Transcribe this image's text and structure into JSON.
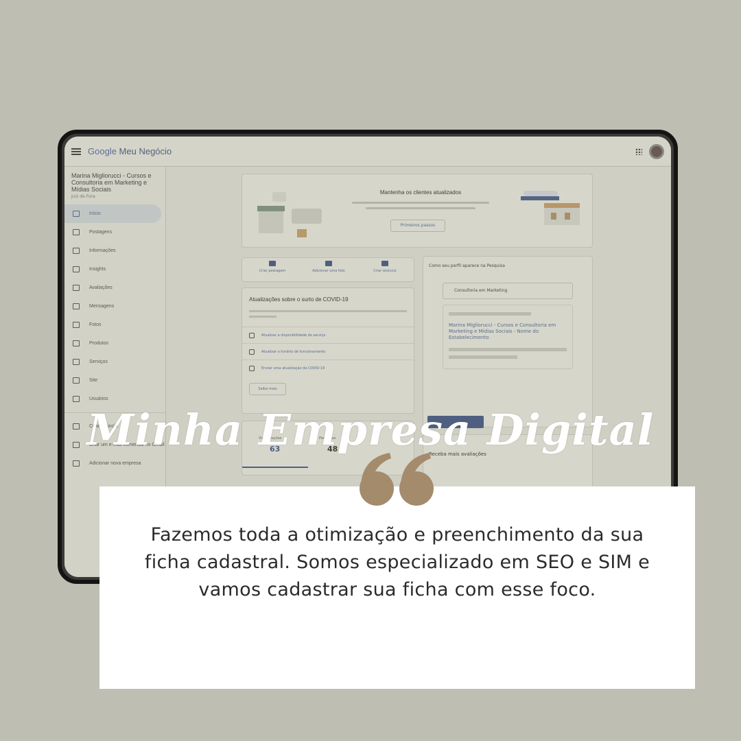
{
  "app": {
    "brand_google": "Google",
    "brand_rest": "Meu Negócio"
  },
  "sidebar": {
    "business_name": "Marina Migliorucci - Cursos e Consultoria em Marketing e Mídias Sociais",
    "location": "Juiz de Fora",
    "items": [
      {
        "label": "Início",
        "icon": "home-icon"
      },
      {
        "label": "Postagens",
        "icon": "posts-icon"
      },
      {
        "label": "Informações",
        "icon": "store-icon"
      },
      {
        "label": "Insights",
        "icon": "insights-icon"
      },
      {
        "label": "Avaliações",
        "icon": "reviews-icon"
      },
      {
        "label": "Mensagens",
        "icon": "messages-icon"
      },
      {
        "label": "Fotos",
        "icon": "photos-icon"
      },
      {
        "label": "Produtos",
        "icon": "products-icon"
      },
      {
        "label": "Serviços",
        "icon": "services-icon"
      },
      {
        "label": "Site",
        "icon": "website-icon"
      },
      {
        "label": "Usuários",
        "icon": "users-icon"
      },
      {
        "label": "Criar anúncio",
        "icon": "ads-icon"
      },
      {
        "label": "Criar um e-mail comercial no Gmail",
        "icon": "gmail-icon"
      },
      {
        "label": "Adicionar nova empresa",
        "icon": "location-icon"
      }
    ]
  },
  "banner": {
    "title": "Mantenha os clientes atualizados",
    "button": "Primeiros passos"
  },
  "actions": [
    "Criar postagem",
    "Adicionar uma foto",
    "Criar anúncio"
  ],
  "covid": {
    "title": "Atualizações sobre o surto de COVID-19",
    "rows": [
      "Atualizar a disponibilidade do serviço",
      "Atualizar o horário de funcionamento",
      "Enviar uma atualização da COVID-19"
    ],
    "more": "Saiba mais"
  },
  "stats": {
    "items": [
      {
        "label": "Visualizações",
        "value": "63"
      },
      {
        "label": "Pesquisas",
        "value": "48"
      }
    ]
  },
  "search_card": {
    "header": "Como seu perfil aparece na Pesquisa",
    "query": "Consultoria em Marketing",
    "result_title": "Marina Migliorucci - Cursos e Consultoria em Marketing e Mídias Sociais - Nome do Estabelecimento",
    "cta": "Começar agora"
  },
  "reviews": {
    "title": "Receba mais avaliações"
  },
  "overlay": {
    "headline": "Minha Empresa Digital",
    "quote_color": "#a48b6c",
    "body": "Fazemos toda a otimização e preenchimento da sua ficha cadastral. Somos especializado em SEO  e  SIM e vamos cadastrar sua ficha com esse foco."
  }
}
